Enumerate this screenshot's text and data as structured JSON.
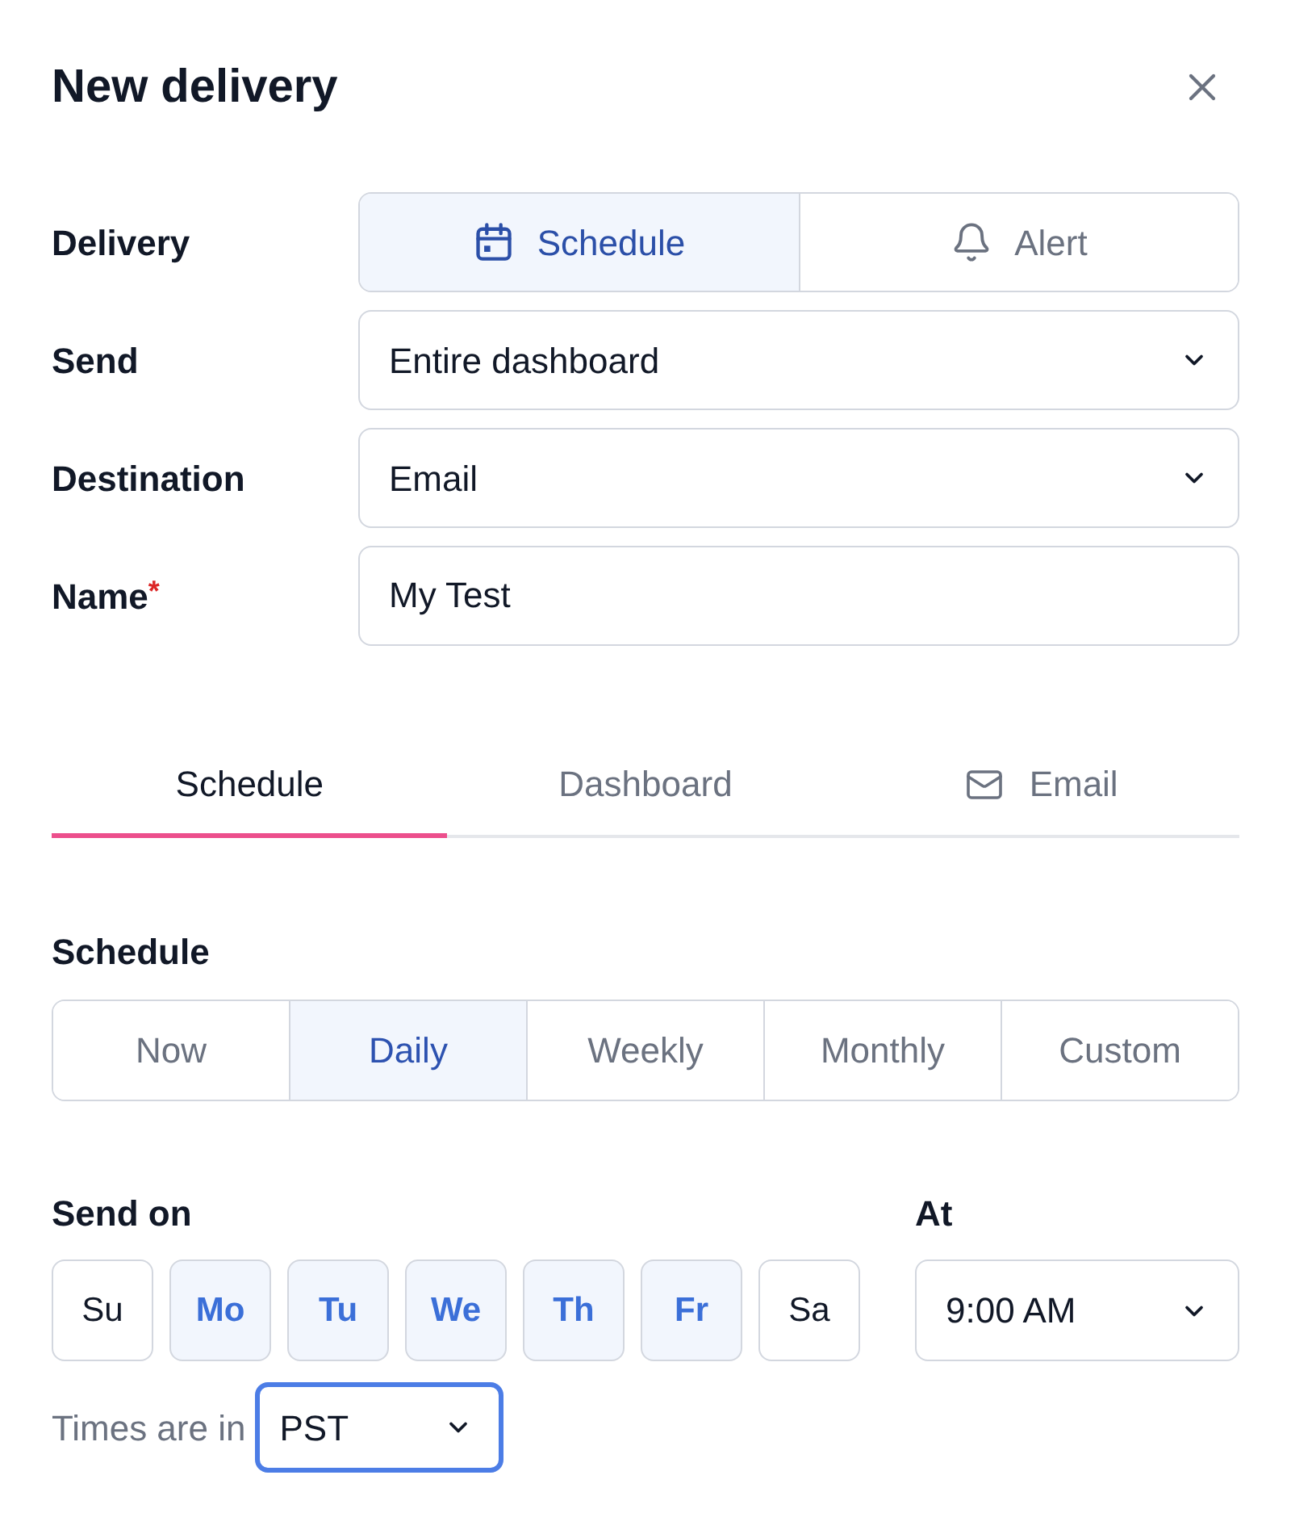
{
  "dialog": {
    "title": "New delivery"
  },
  "form": {
    "delivery": {
      "label": "Delivery",
      "options": [
        {
          "label": "Schedule",
          "selected": true
        },
        {
          "label": "Alert",
          "selected": false
        }
      ]
    },
    "send": {
      "label": "Send",
      "value": "Entire dashboard"
    },
    "destination": {
      "label": "Destination",
      "value": "Email"
    },
    "name": {
      "label": "Name",
      "required_mark": "*",
      "value": "My Test"
    }
  },
  "tabs": [
    {
      "label": "Schedule",
      "selected": true
    },
    {
      "label": "Dashboard",
      "selected": false
    },
    {
      "label": "Email",
      "selected": false
    }
  ],
  "schedule": {
    "label": "Schedule",
    "options": [
      {
        "label": "Now",
        "selected": false
      },
      {
        "label": "Daily",
        "selected": true
      },
      {
        "label": "Weekly",
        "selected": false
      },
      {
        "label": "Monthly",
        "selected": false
      },
      {
        "label": "Custom",
        "selected": false
      }
    ]
  },
  "send_on": {
    "label": "Send on",
    "days": [
      {
        "label": "Su",
        "selected": false
      },
      {
        "label": "Mo",
        "selected": true
      },
      {
        "label": "Tu",
        "selected": true
      },
      {
        "label": "We",
        "selected": true
      },
      {
        "label": "Th",
        "selected": true
      },
      {
        "label": "Fr",
        "selected": true
      },
      {
        "label": "Sa",
        "selected": false
      }
    ]
  },
  "at": {
    "label": "At",
    "value": "9:00 AM"
  },
  "timezone": {
    "label": "Times are in",
    "value": "PST",
    "focused": true
  }
}
